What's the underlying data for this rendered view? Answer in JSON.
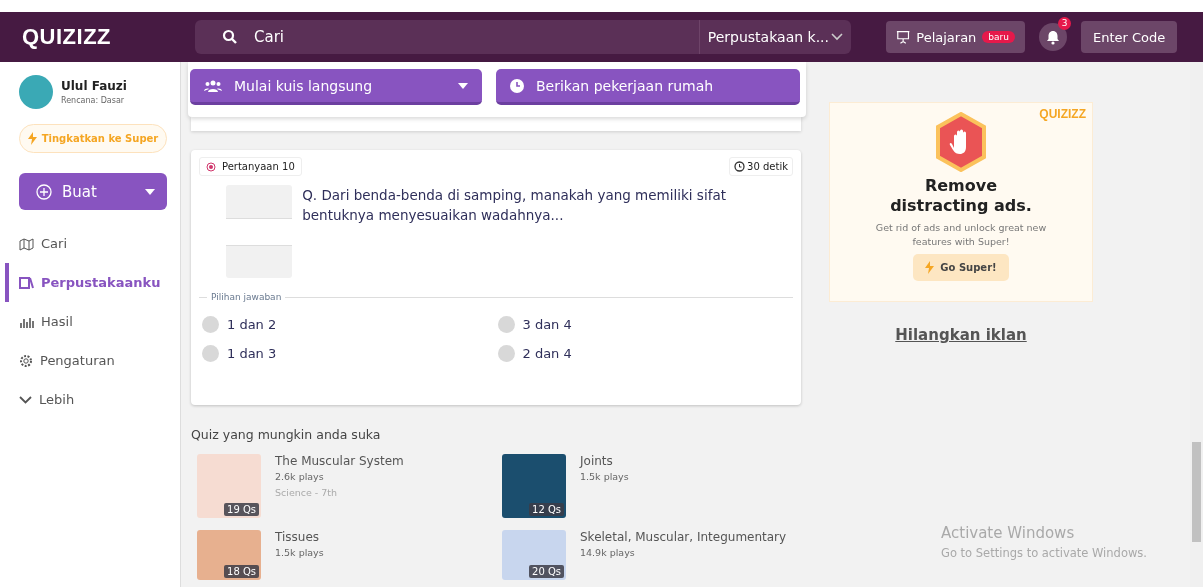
{
  "header": {
    "logo": "QUIZIZZ",
    "search": {
      "placeholder": "Cari"
    },
    "library_select": "Perpustakaan k...",
    "lesson_button": {
      "label": "Pelajaran",
      "badge": "baru"
    },
    "notifications": "3",
    "enter_code": "Enter Code"
  },
  "sidebar": {
    "user": {
      "name": "Ulul Fauzi",
      "plan": "Rencana: Dasar"
    },
    "upgrade": "Tingkatkan ke Super",
    "create": "Buat",
    "items": [
      {
        "label": "Cari",
        "kind": "search",
        "selected": false
      },
      {
        "label": "Perpustakaanku",
        "kind": "library",
        "selected": true
      },
      {
        "label": "Hasil",
        "kind": "results",
        "selected": false
      },
      {
        "label": "Pengaturan",
        "kind": "settings",
        "selected": false
      },
      {
        "label": "Lebih",
        "kind": "more",
        "selected": false
      }
    ]
  },
  "actions": [
    {
      "label": "Mulai kuis langsung",
      "kind": "live"
    },
    {
      "label": "Berikan pekerjaan rumah",
      "kind": "homework"
    }
  ],
  "question": {
    "number": "Pertanyaan 10",
    "time": "30 detik",
    "text": "Q. Dari benda-benda di samping, manakah yang memiliki sifat bentuknya menyesuaikan wadahnya...",
    "choices_label": "Pilihan jawaban",
    "choices": [
      {
        "label": "1 dan 2",
        "selected": false
      },
      {
        "label": "3 dan 4",
        "selected": false
      },
      {
        "label": "1 dan 3",
        "selected": false
      },
      {
        "label": "2 dan 4",
        "selected": false
      }
    ]
  },
  "recommended": {
    "title": "Quiz yang mungkin anda suka",
    "quizzes": [
      {
        "title": "The Muscular System",
        "plays": "2.6k plays",
        "subject": "Science - 7th",
        "questions": "19 Qs"
      },
      {
        "title": "Joints",
        "plays": "1.5k plays",
        "questions": "12 Qs"
      },
      {
        "title": "Tissues",
        "plays": "1.5k plays",
        "questions": "18 Qs"
      },
      {
        "title": "Skeletal, Muscular, Integumentary",
        "plays": "14.9k plays",
        "questions": "20 Qs"
      }
    ]
  },
  "ad": {
    "logo": "QUIZIZZ",
    "title": "Remove distracting ads.",
    "text": "Get  rid of ads and unlock great new features with Super!",
    "button": "Go Super!",
    "remove_link": "Hilangkan iklan"
  },
  "windows_notice": {
    "title": "Activate Windows",
    "text": "Go to Settings to activate Windows."
  }
}
